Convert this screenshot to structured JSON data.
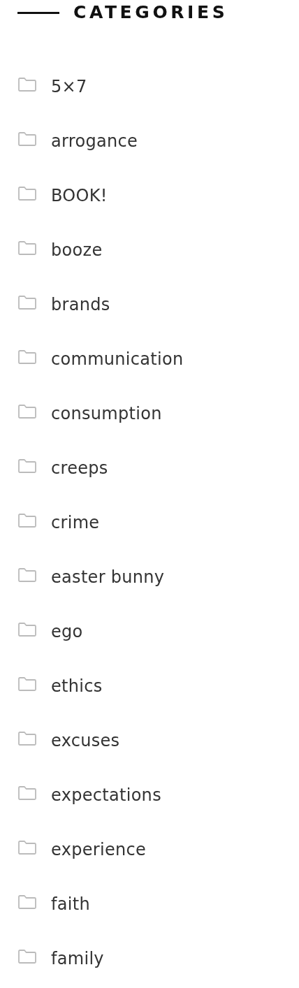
{
  "heading": "CATEGORIES",
  "categories": [
    {
      "label": "5×7"
    },
    {
      "label": "arrogance"
    },
    {
      "label": "BOOK!"
    },
    {
      "label": "booze"
    },
    {
      "label": "brands"
    },
    {
      "label": "communication"
    },
    {
      "label": "consumption"
    },
    {
      "label": "creeps"
    },
    {
      "label": "crime"
    },
    {
      "label": "easter bunny"
    },
    {
      "label": "ego"
    },
    {
      "label": "ethics"
    },
    {
      "label": "excuses"
    },
    {
      "label": "expectations"
    },
    {
      "label": "experience"
    },
    {
      "label": "faith"
    },
    {
      "label": "family"
    }
  ]
}
